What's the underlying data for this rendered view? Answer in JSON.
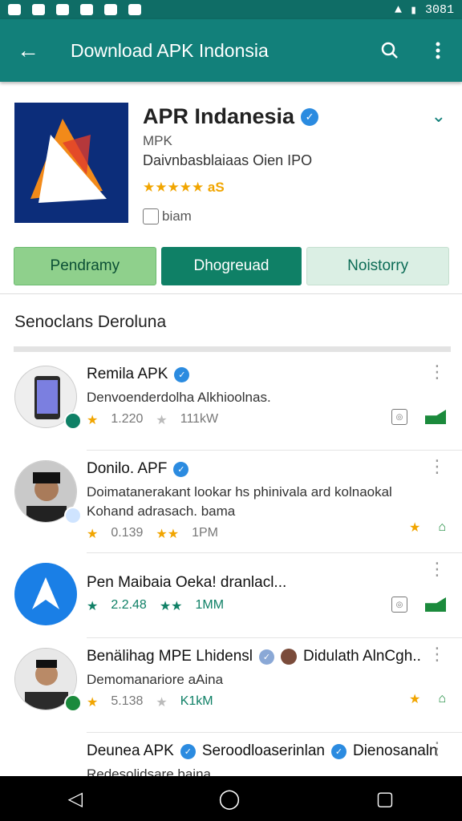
{
  "status_bar": {
    "left_icons": [
      "notification-icon",
      "notification-icon",
      "notification-icon",
      "notification-icon",
      "notification-icon",
      "notification-icon"
    ],
    "time": "3081"
  },
  "app_bar": {
    "title": "Download APK Indonsia",
    "back_icon": "arrow-left-icon",
    "search_icon": "search-icon",
    "more_icon": "kebab-icon"
  },
  "header": {
    "app_name": "APR Indanesia",
    "developer": "MPK",
    "description": "Daivnbasblaiaas Oien IPO",
    "rating_text": "★★★★★ aS",
    "installs": "biam",
    "buttons": [
      "Pendramy",
      "Dhogreuad",
      "Noistorry"
    ]
  },
  "section": {
    "title": "Senoclans Deroluna"
  },
  "list": [
    {
      "title": "Remila APK",
      "desc": "Denvoenderdolha Alkhioolnas.",
      "rating": "1.220",
      "count": "111kW"
    },
    {
      "title": "Donilo. APF",
      "desc": "Doimatanerakant lookar hs phinivala ard kolnaokal Kohand adrasach. bama",
      "rating": "0.139",
      "count": "1PM"
    },
    {
      "title": "Pen Maibaia Oeka! dranlacl...",
      "desc": "",
      "rating": "2.2.48",
      "count": "1MM"
    },
    {
      "title": "Benälihag MPE Lhidensl",
      "title_extra": "Didulath AlnCgh..",
      "desc": "Demomanariore aAina",
      "rating": "5.138",
      "count": "K1kM"
    },
    {
      "title": "Deunea APK",
      "title_extra": "Seroodloaserinlan",
      "title_extra2": "Dienosanaln",
      "desc": "Redesolidsare baina",
      "rating": "",
      "count": ""
    }
  ],
  "nav": {
    "back": "◁",
    "home": "◯",
    "recents": "▢"
  }
}
